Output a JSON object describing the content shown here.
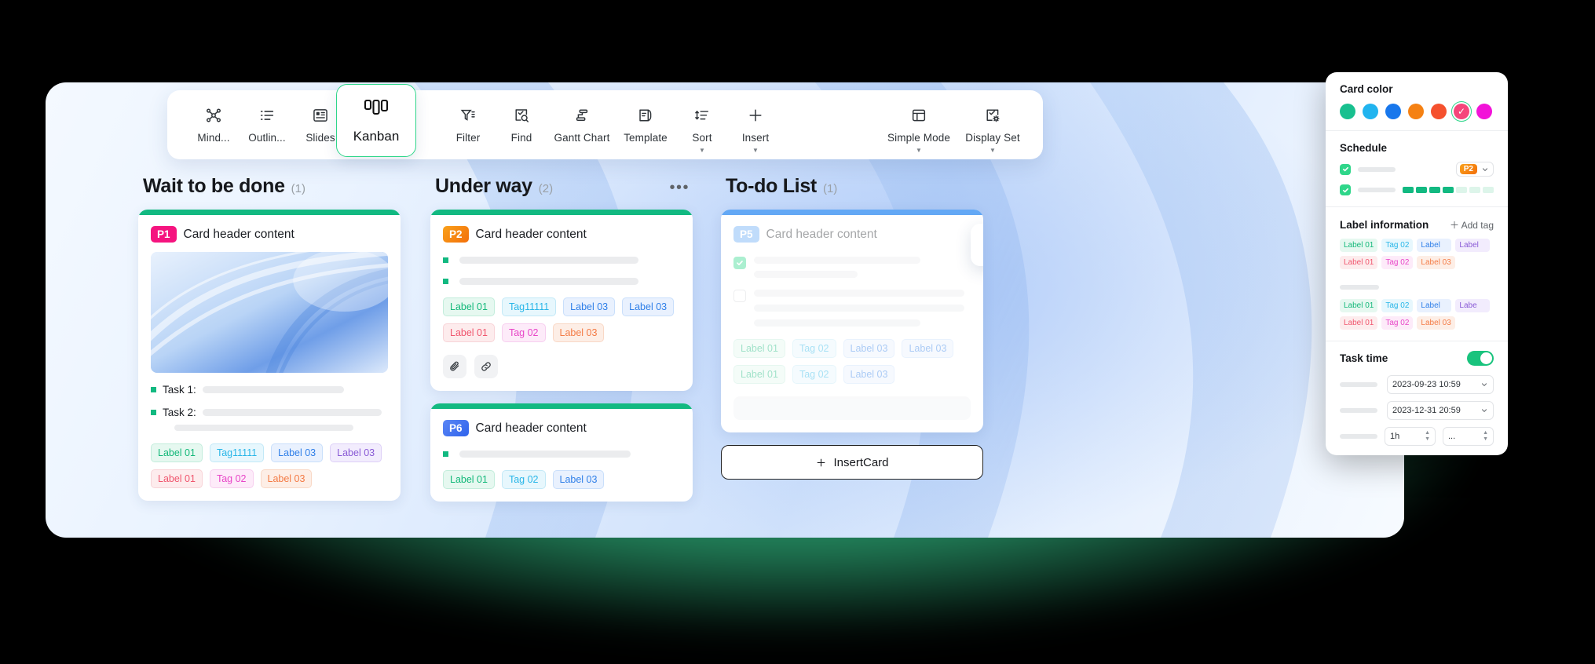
{
  "toolbar": {
    "items": [
      {
        "label": "Mind...",
        "icon": "mindmap-icon",
        "caret": false
      },
      {
        "label": "Outlin...",
        "icon": "outline-icon",
        "caret": false
      },
      {
        "label": "Slides",
        "icon": "slides-icon",
        "caret": false
      },
      {
        "label": "Filter",
        "icon": "filter-icon",
        "caret": false
      },
      {
        "label": "Find",
        "icon": "find-icon",
        "caret": false
      },
      {
        "label": "Gantt Chart",
        "icon": "gantt-icon",
        "caret": false
      },
      {
        "label": "Template",
        "icon": "template-icon",
        "caret": false
      },
      {
        "label": "Sort",
        "icon": "sort-icon",
        "caret": true
      },
      {
        "label": "Insert",
        "icon": "plus-icon",
        "caret": true
      },
      {
        "label": "Simple Mode",
        "icon": "layout-icon",
        "caret": true
      },
      {
        "label": "Display Set",
        "icon": "display-set-icon",
        "caret": true
      }
    ],
    "active_tab": {
      "label": "Kanban",
      "icon": "kanban-icon"
    }
  },
  "board": {
    "columns": [
      {
        "title": "Wait to be done",
        "count": "(1)",
        "bar_color": "#12b981",
        "show_more": false,
        "cards": [
          {
            "priority": "P1",
            "priority_color": "#f5147f",
            "title": "Card header content",
            "has_image": true,
            "tasks": [
              {
                "label": "Task 1:",
                "skel_w": 180
              },
              {
                "label": "Task 2:",
                "skel_w": 228
              }
            ],
            "extra_skel_w": 228,
            "tags_row1": [
              {
                "text": "Label 01",
                "color": "#14b87a",
                "bg": "#e6f8f0",
                "border": "#c3eddc"
              },
              {
                "text": "Tag11111",
                "color": "#29b6e8",
                "bg": "#e7f7fd",
                "border": "#c3e9f7"
              },
              {
                "text": "Label 03",
                "color": "#2f7fe8",
                "bg": "#e9f1fe",
                "border": "#c9dffb"
              },
              {
                "text": "Label 03",
                "color": "#8a5bd6",
                "bg": "#f2ecfd",
                "border": "#ddd0f7"
              }
            ],
            "tags_row2": [
              {
                "text": "Label 01",
                "color": "#f0566e",
                "bg": "#fdeced",
                "border": "#f8d4d8"
              },
              {
                "text": "Tag 02",
                "color": "#e846c8",
                "bg": "#fdebf9",
                "border": "#f7cfef"
              },
              {
                "text": "Label 03",
                "color": "#f47b45",
                "bg": "#fdeee6",
                "border": "#f9d8c6"
              }
            ]
          }
        ]
      },
      {
        "title": "Under way",
        "count": "(2)",
        "bar_color": "#12b981",
        "show_more": true,
        "more_glyph": "•••",
        "cards": [
          {
            "priority": "P2",
            "priority_color": "#f58113",
            "title": "Card header content",
            "has_image": false,
            "bullet_rows": [
              228,
              228
            ],
            "tags_row1": [
              {
                "text": "Label 01",
                "color": "#14b87a",
                "bg": "#e6f8f0",
                "border": "#c3eddc"
              },
              {
                "text": "Tag11111",
                "color": "#29b6e8",
                "bg": "#e7f7fd",
                "border": "#c3e9f7"
              },
              {
                "text": "Label 03",
                "color": "#2f7fe8",
                "bg": "#e9f1fe",
                "border": "#c9dffb"
              },
              {
                "text": "Label 03",
                "color": "#2f7fe8",
                "bg": "#e9f1fe",
                "border": "#c9dffb"
              }
            ],
            "tags_row2": [
              {
                "text": "Label 01",
                "color": "#f0566e",
                "bg": "#fdeced",
                "border": "#f8d4d8"
              },
              {
                "text": "Tag 02",
                "color": "#e846c8",
                "bg": "#fdebf9",
                "border": "#f7cfef"
              },
              {
                "text": "Label 03",
                "color": "#f47b45",
                "bg": "#fdeee6",
                "border": "#f9d8c6"
              }
            ],
            "actions": [
              "attachment-icon",
              "link-icon"
            ]
          },
          {
            "priority": "P6",
            "priority_color": "#3b6ef0",
            "title": "Card header content",
            "has_image": false,
            "bullet_rows": [
              218
            ],
            "tags_row1": [
              {
                "text": "Label 01",
                "color": "#14b87a",
                "bg": "#e6f8f0",
                "border": "#c3eddc"
              },
              {
                "text": "Tag 02",
                "color": "#29b6e8",
                "bg": "#e7f7fd",
                "border": "#c3e9f7"
              },
              {
                "text": "Label 03",
                "color": "#2f7fe8",
                "bg": "#e9f1fe",
                "border": "#c9dffb"
              }
            ],
            "tags_row2": []
          }
        ]
      },
      {
        "title": "To-do List",
        "count": "(1)",
        "bar_color": "#63a8f5",
        "show_more": false,
        "faded": true,
        "lock_icon": "lock-icon",
        "cards": [
          {
            "priority": "P5",
            "priority_color": "#63a8f5",
            "title": "Card header content",
            "has_image": false,
            "check_rows": [
              {
                "checked": true,
                "lines": [
                  212,
                  132
                ]
              },
              {
                "checked": false,
                "lines": [
                  268,
                  268,
                  212
                ]
              }
            ],
            "tags_row1": [
              {
                "text": "Label 01",
                "color": "#14b87a",
                "bg": "#e6f8f0",
                "border": "#c3eddc"
              },
              {
                "text": "Tag 02",
                "color": "#29b6e8",
                "bg": "#e7f7fd",
                "border": "#c3e9f7"
              },
              {
                "text": "Label 03",
                "color": "#2f7fe8",
                "bg": "#e9f1fe",
                "border": "#c9dffb"
              },
              {
                "text": "Label 03",
                "color": "#2f7fe8",
                "bg": "#e9f1fe",
                "border": "#c9dffb"
              }
            ],
            "tags_row2": [
              {
                "text": "Label 01",
                "color": "#14b87a",
                "bg": "#e6f8f0",
                "border": "#c3eddc"
              },
              {
                "text": "Tag 02",
                "color": "#29b6e8",
                "bg": "#e7f7fd",
                "border": "#c3e9f7"
              },
              {
                "text": "Label 03",
                "color": "#2f7fe8",
                "bg": "#e9f1fe",
                "border": "#c9dffb"
              }
            ],
            "footer_skel": true
          }
        ],
        "insert_card_label": "InsertCard",
        "insert_card_icon": "plus-icon"
      }
    ]
  },
  "panel": {
    "card_color": {
      "title": "Card color",
      "swatches": [
        "#18c08f",
        "#21b4ef",
        "#1877ec",
        "#f58113",
        "#f5512e",
        "#f5467a",
        "#f213d8"
      ],
      "selected_index": 5
    },
    "schedule": {
      "title": "Schedule",
      "row1": {
        "checked": true,
        "priority": "P2",
        "priority_color": "#f58113",
        "caret": "chevron-down-icon"
      },
      "row2": {
        "checked": true,
        "filled_segments": 4,
        "total_segments": 7,
        "fill_color": "#12b981",
        "empty_color": "#ddf5ea"
      }
    },
    "label_information": {
      "title": "Label information",
      "add_tag_label": "Add tag",
      "add_tag_icon": "plus-icon",
      "group1_row1": [
        {
          "text": "Label 01",
          "color": "#14b87a",
          "bg": "#e6f8f0"
        },
        {
          "text": "Tag 02",
          "color": "#29b6e8",
          "bg": "#e7f7fd"
        },
        {
          "text": "Label",
          "color": "#2f7fe8",
          "bg": "#e9f1fe"
        },
        {
          "text": "Label",
          "color": "#8a5bd6",
          "bg": "#f2ecfd"
        }
      ],
      "group1_row2": [
        {
          "text": "Label 01",
          "color": "#f0566e",
          "bg": "#fdeced"
        },
        {
          "text": "Tag 02",
          "color": "#e846c8",
          "bg": "#fdebf9"
        },
        {
          "text": "Label 03",
          "color": "#f47b45",
          "bg": "#fdeee6"
        }
      ],
      "group2_row1": [
        {
          "text": "Label 01",
          "color": "#14b87a",
          "bg": "#e6f8f0"
        },
        {
          "text": "Tag 02",
          "color": "#29b6e8",
          "bg": "#e7f7fd"
        },
        {
          "text": "Label",
          "color": "#2f7fe8",
          "bg": "#e9f1fe"
        },
        {
          "text": "Labe",
          "color": "#8a5bd6",
          "bg": "#f2ecfd"
        }
      ],
      "group2_row2": [
        {
          "text": "Label 01",
          "color": "#f0566e",
          "bg": "#fdeced"
        },
        {
          "text": "Tag 02",
          "color": "#e846c8",
          "bg": "#fdebf9"
        },
        {
          "text": "Label 03",
          "color": "#f47b45",
          "bg": "#fdeee6"
        }
      ]
    },
    "task_time": {
      "title": "Task time",
      "toggle_on": true,
      "toggle_color": "#19c37d",
      "start_date": "2023-09-23 10:59",
      "end_date": "2023-12-31 20:59",
      "duration": "1h",
      "reminder": "...",
      "footer_checked": true
    }
  }
}
